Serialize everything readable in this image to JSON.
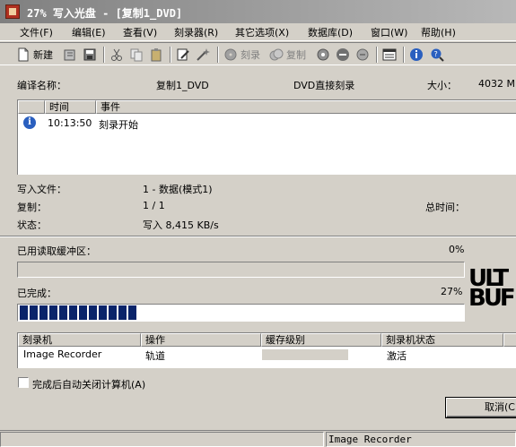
{
  "window": {
    "title": "27% 写入光盘 - [复制1_DVD]"
  },
  "menu": [
    "文件(F)",
    "编辑(E)",
    "查看(V)",
    "刻录器(R)",
    "其它选项(X)",
    "数据库(D)",
    "窗口(W)",
    "帮助(H)"
  ],
  "toolbar": {
    "new_label": "新建",
    "burn_label": "刻录",
    "copy_label": "复制"
  },
  "info": {
    "compile_name_label": "编译名称：",
    "compile_name_value": "复制1_DVD",
    "mode_value": "DVD直接刻录",
    "size_label": "大小：",
    "size_value": "4032 MB"
  },
  "log": {
    "columns": [
      "时间",
      "事件"
    ],
    "rows": [
      {
        "icon": "info-icon",
        "time": "10:13:50",
        "event": "刻录开始"
      }
    ]
  },
  "details": {
    "write_file_label": "写入文件：",
    "write_file_value": "1 - 数据(模式1)",
    "copies_label": "复制：",
    "copies_value": "1 / 1",
    "total_time_label": "总时间：",
    "status_label": "状态：",
    "status_value": "写入 8,415 KB/s"
  },
  "buffer": {
    "label": "已用读取缓冲区：",
    "value_text": "0%",
    "fraction": 0.0
  },
  "progress": {
    "label": "已完成：",
    "value_text": "27%",
    "fraction": 0.27
  },
  "logo_text": [
    "ULT",
    "BUF"
  ],
  "recorders": {
    "columns": [
      "刻录机",
      "操作",
      "缓存级别",
      "刻录机状态"
    ],
    "rows": [
      {
        "recorder": "Image Recorder",
        "operation": "轨道",
        "buffer_level": 0,
        "state": "激活"
      }
    ]
  },
  "auto_shutdown_label": "完成后自动关闭计算机(A)",
  "cancel_label": "取消(C)",
  "statusbar": {
    "recorder": "Image Recorder"
  },
  "colors": {
    "progress": "#0a246a",
    "face": "#d4d0c8",
    "info": "#2a5fbf"
  }
}
